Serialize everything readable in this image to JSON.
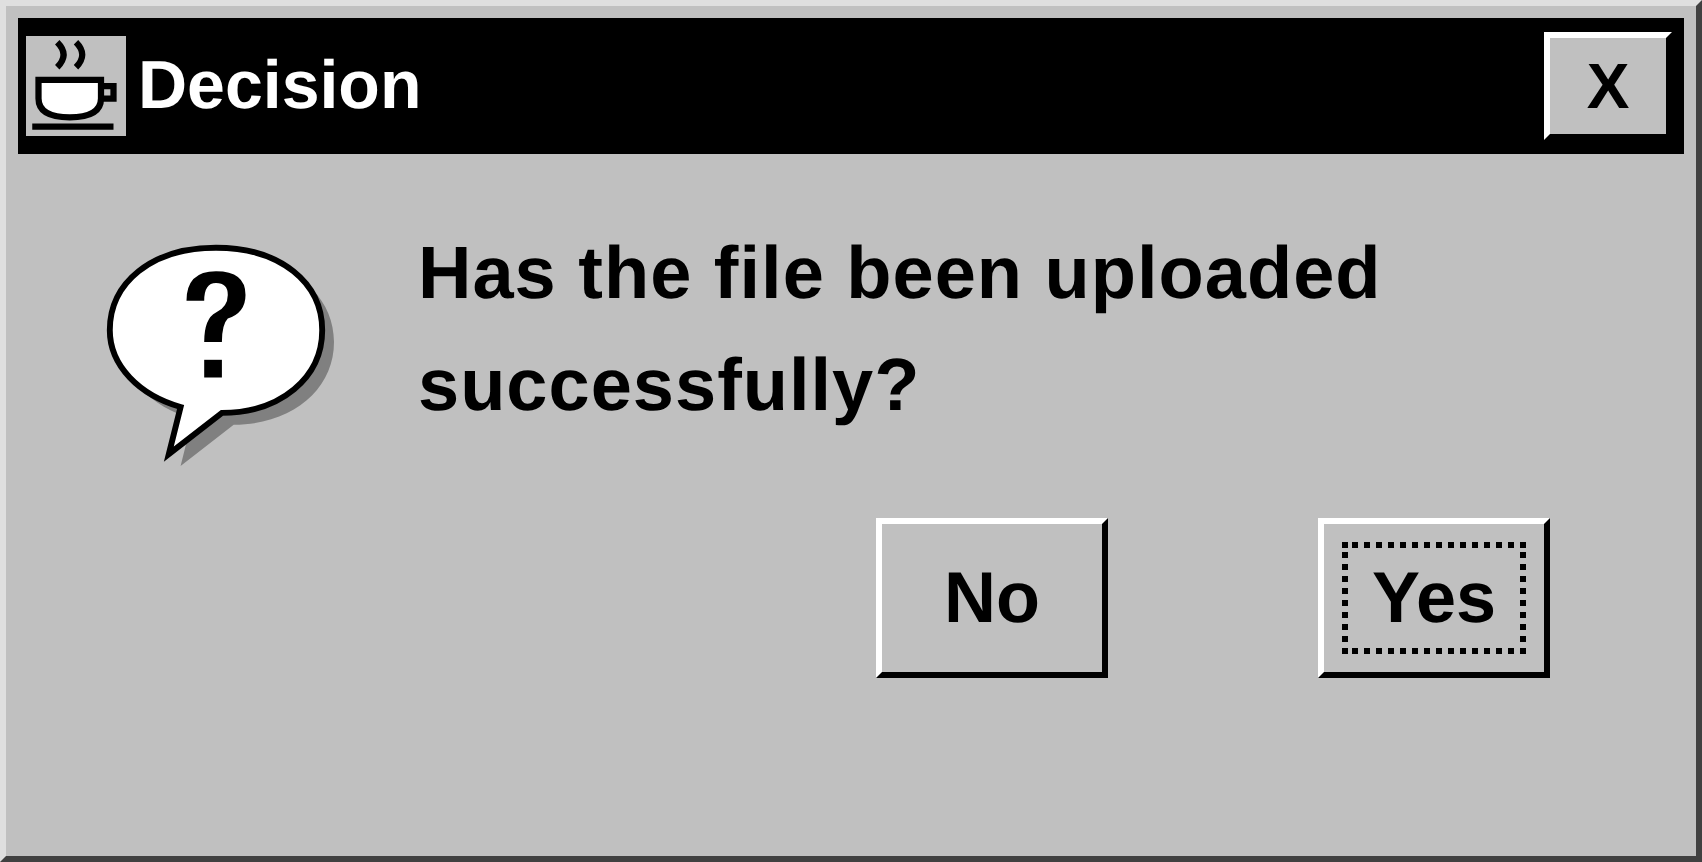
{
  "window": {
    "title": "Decision",
    "close": "X"
  },
  "message": "Has the file been uploaded successfully?",
  "buttons": [
    {
      "label": "No",
      "focused": false
    },
    {
      "label": "Yes",
      "focused": true
    }
  ]
}
